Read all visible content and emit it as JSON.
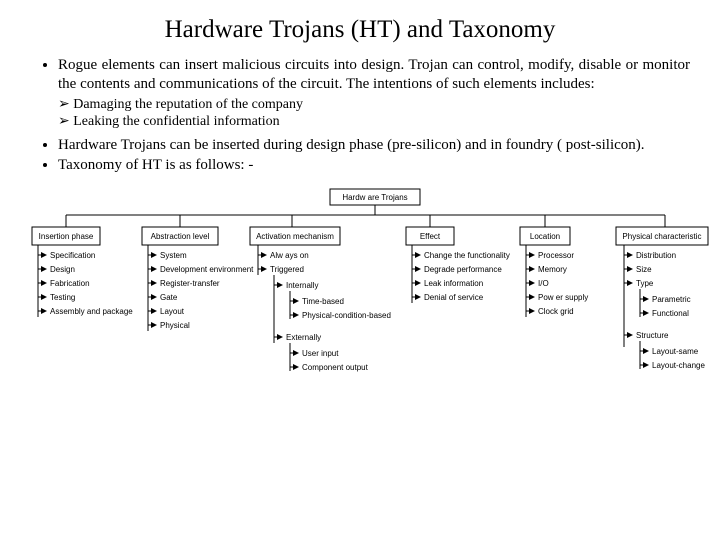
{
  "title": "Hardware Trojans (HT) and Taxonomy",
  "bullets": {
    "b1": "Rogue elements can insert malicious circuits into design. Trojan can control, modify, disable or monitor the contents and communications of the circuit. The intentions of such elements includes:",
    "s1": "Damaging the reputation of the company",
    "s2": "Leaking the confidential information",
    "b2": "Hardware Trojans can be inserted during design phase (pre-silicon) and in foundry ( post-silicon).",
    "b3": "Taxonomy of HT is as follows: -"
  },
  "diagram": {
    "root": "Hardw are Trojans",
    "categories": [
      {
        "name": "Insertion phase",
        "items": [
          "Specification",
          "Design",
          "Fabrication",
          "Testing",
          "Assembly and package"
        ]
      },
      {
        "name": "Abstraction level",
        "items": [
          "System",
          "Development environment",
          "Register-transfer",
          "Gate",
          "Layout",
          "Physical"
        ]
      },
      {
        "name": "Activation mechanism",
        "items": [
          "Alw ays on",
          "Triggered"
        ],
        "sub": {
          "parent": "Triggered",
          "items": [
            "Internally",
            "Externally"
          ],
          "sub2a": {
            "parent": "Internally",
            "items": [
              "Time-based",
              "Physical-condition-based"
            ]
          },
          "sub2b": {
            "parent": "Externally",
            "items": [
              "User input",
              "Component output"
            ]
          }
        }
      },
      {
        "name": "Effect",
        "items": [
          "Change the functionality",
          "Degrade performance",
          "Leak information",
          "Denial of service"
        ]
      },
      {
        "name": "Location",
        "items": [
          "Processor",
          "Memory",
          "I/O",
          "Pow er supply",
          "Clock grid"
        ]
      },
      {
        "name": "Physical characteristic",
        "items": [
          "Distribution",
          "Size",
          "Type",
          "Structure"
        ],
        "sub": {
          "parent": "Type",
          "items": [
            "Parametric",
            "Functional"
          ]
        },
        "sub2": {
          "parent": "Structure",
          "items": [
            "Layout-same",
            "Layout-change"
          ]
        }
      }
    ]
  }
}
